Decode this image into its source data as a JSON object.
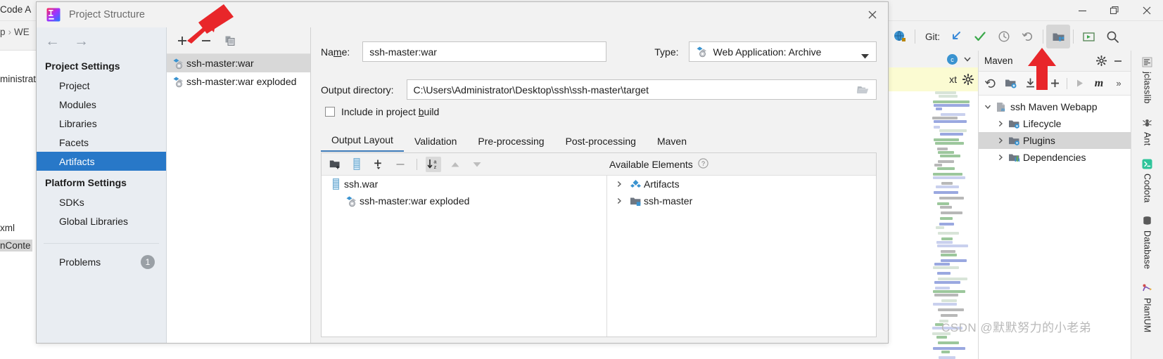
{
  "ide": {
    "menu_text": "Code   A",
    "breadcrumb_left": "p",
    "breadcrumb_sep": "›",
    "breadcrumb_right": "WE",
    "editor_line_1": "ministrat",
    "editor_line_2": "xml",
    "editor_line_3_selected": "nConte",
    "window_controls": [
      {
        "name": "minimize-window-button",
        "glyph": "minimize"
      },
      {
        "name": "restore-window-button",
        "glyph": "restore"
      },
      {
        "name": "close-window-button",
        "glyph": "close"
      }
    ],
    "git": {
      "label": "Git:",
      "actions": [
        {
          "name": "git-update-project-icon",
          "title": "Update Project"
        },
        {
          "name": "git-commit-icon",
          "title": "Commit"
        },
        {
          "name": "git-history-icon",
          "title": "History"
        },
        {
          "name": "git-rollback-icon",
          "title": "Rollback"
        },
        {
          "name": "project-structure-icon",
          "title": "Project Structure",
          "active": true
        },
        {
          "name": "run-configurations-icon",
          "title": "Run"
        },
        {
          "name": "search-everywhere-icon",
          "title": "Search"
        }
      ]
    }
  },
  "maven": {
    "title": "Maven",
    "header_buttons": [
      {
        "name": "maven-settings-gear-icon"
      },
      {
        "name": "maven-hide-icon"
      }
    ],
    "toolbar": [
      {
        "name": "maven-reload-icon"
      },
      {
        "name": "maven-add-project-icon"
      },
      {
        "name": "maven-download-sources-icon"
      },
      {
        "name": "maven-add-icon"
      },
      {
        "name": "maven-run-icon"
      },
      {
        "name": "maven-execute-goal-icon"
      },
      {
        "name": "maven-more-icon"
      }
    ],
    "tree": [
      {
        "label": "ssh Maven Webapp",
        "indent": 0,
        "expanded": true,
        "icon": "maven-module-icon",
        "selected": false
      },
      {
        "label": "Lifecycle",
        "indent": 1,
        "expanded": false,
        "icon": "maven-folder-icon",
        "selected": false
      },
      {
        "label": "Plugins",
        "indent": 1,
        "expanded": false,
        "icon": "maven-folder-icon",
        "selected": true
      },
      {
        "label": "Dependencies",
        "indent": 1,
        "expanded": false,
        "icon": "maven-deps-icon",
        "selected": false
      }
    ]
  },
  "right_rail": {
    "tabs": [
      {
        "label": "jclasslib",
        "icon": "jclasslib-icon"
      },
      {
        "label": "Ant",
        "icon": "ant-icon"
      },
      {
        "label": "Codota",
        "icon": "codota-icon"
      },
      {
        "label": "Database",
        "icon": "database-icon"
      },
      {
        "label": "PlantUM",
        "icon": "plantuml-icon"
      }
    ]
  },
  "watermark": "CSDN @默默努力的小老弟",
  "dialog": {
    "title": "Project Structure",
    "close_label": "✕",
    "nav": {
      "back": "←",
      "forward": "→"
    },
    "sidebar": {
      "groups": [
        {
          "title": "Project Settings",
          "items": [
            {
              "label": "Project",
              "selected": false
            },
            {
              "label": "Modules",
              "selected": false
            },
            {
              "label": "Libraries",
              "selected": false
            },
            {
              "label": "Facets",
              "selected": false
            },
            {
              "label": "Artifacts",
              "selected": true
            }
          ]
        },
        {
          "title": "Platform Settings",
          "items": [
            {
              "label": "SDKs",
              "selected": false
            },
            {
              "label": "Global Libraries",
              "selected": false
            }
          ]
        }
      ],
      "problems": {
        "label": "Problems",
        "count": "1"
      }
    },
    "artifacts_toolbar": [
      {
        "name": "add-artifact-button",
        "glyph": "plus"
      },
      {
        "name": "remove-artifact-button",
        "glyph": "minus"
      },
      {
        "name": "copy-artifact-button",
        "glyph": "copy"
      }
    ],
    "artifacts": [
      {
        "label": "ssh-master:war",
        "selected": true
      },
      {
        "label": "ssh-master:war exploded",
        "selected": false
      }
    ],
    "fields": {
      "name_label_pre": "Na",
      "name_label_mnemonic": "m",
      "name_label_post": "e:",
      "name_value": "ssh-master:war",
      "type_label": "Type:",
      "type_value": "Web Application: Archive",
      "output_dir_label": "Output directory:",
      "output_dir_value": "C:\\Users\\Administrator\\Desktop\\ssh\\ssh-master\\target",
      "include_pre": "Include in project ",
      "include_mnemonic": "b",
      "include_post": "uild",
      "include_checked": false
    },
    "tabs": [
      {
        "label": "Output Layout",
        "active": true
      },
      {
        "label": "Validation",
        "active": false
      },
      {
        "label": "Pre-processing",
        "active": false
      },
      {
        "label": "Post-processing",
        "active": false
      },
      {
        "label": "Maven",
        "active": false
      }
    ],
    "layout_toolbar": [
      {
        "name": "create-directory-button",
        "glyph": "newdir"
      },
      {
        "name": "create-archive-button",
        "glyph": "archive"
      },
      {
        "name": "add-copy-of-button",
        "glyph": "plus-dropdown"
      },
      {
        "name": "remove-element-button",
        "glyph": "minus"
      },
      {
        "name": "sort-elements-button",
        "glyph": "sort-az",
        "active": true
      },
      {
        "name": "move-up-button",
        "glyph": "up"
      },
      {
        "name": "move-down-button",
        "glyph": "down"
      }
    ],
    "available_elements": {
      "label": "Available Elements",
      "help": "?"
    },
    "output_tree": [
      {
        "label": "ssh.war",
        "indent": 0,
        "icon": "archive-icon"
      },
      {
        "label": "ssh-master:war exploded",
        "indent": 1,
        "icon": "artifact-icon"
      }
    ],
    "available_tree": [
      {
        "label": "Artifacts",
        "indent": 0,
        "icon": "artifacts-group-icon",
        "expandable": true
      },
      {
        "label": "ssh-master",
        "indent": 0,
        "icon": "module-icon",
        "expandable": true
      }
    ]
  },
  "colors": {
    "selection_blue": "#2878c8",
    "row_gray": "#d8d8d8",
    "dialog_bg": "#f2f2f2",
    "sidebar_bg": "#e9edf2",
    "arrow_red": "#e8262a",
    "tab_underline": "#3d7ab8"
  }
}
